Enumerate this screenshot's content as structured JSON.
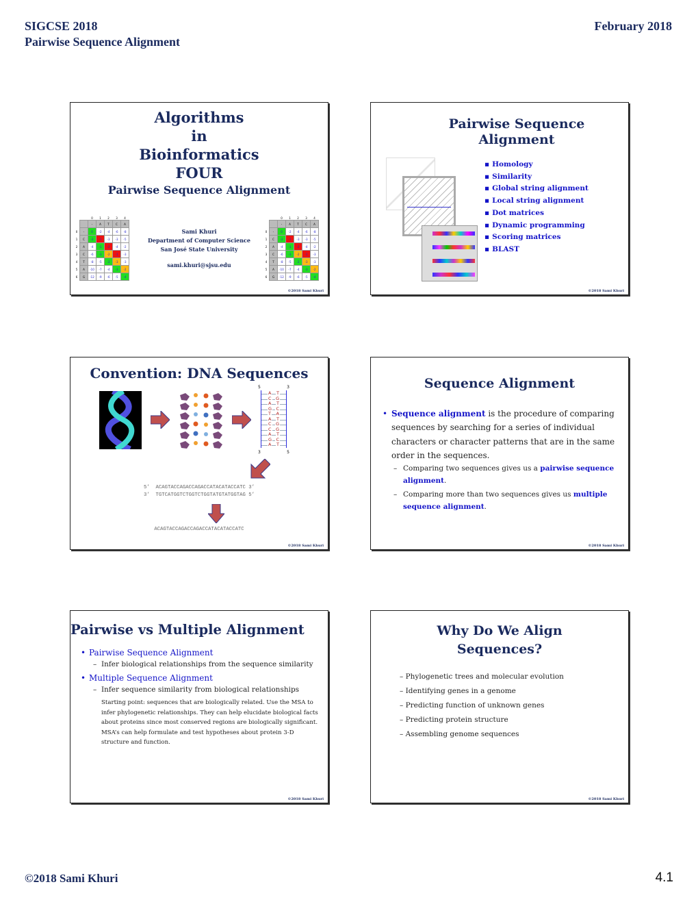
{
  "header": {
    "conference": "SIGCSE 2018",
    "date": "February 2018",
    "subtitle": "Pairwise Sequence Alignment"
  },
  "footer": {
    "copyright": "©2018 Sami Khuri",
    "page_number": "4.1"
  },
  "slide_copyright": "©2018 Sami Khuri",
  "slides": {
    "s1": {
      "title_lines": [
        "Algorithms",
        "in",
        "Bioinformatics"
      ],
      "four": "FOUR",
      "subtitle": "Pairwise Sequence Alignment",
      "author": "Sami Khuri",
      "department": "Department of Computer Science",
      "university": "San José State University",
      "email": "sami.khuri@sjsu.edu",
      "matrix": {
        "col_index": [
          "0",
          "1",
          "2",
          "3",
          "4"
        ],
        "col_header": [
          "-",
          "A",
          "T",
          "C",
          "A"
        ],
        "rows": [
          {
            "idx": "0",
            "label": "-",
            "cells": [
              "0",
              "-2",
              "-4",
              "-6",
              "-8"
            ],
            "colors": [
              "g",
              "",
              "",
              "",
              ""
            ]
          },
          {
            "idx": "1",
            "label": "C",
            "cells": [
              "-2",
              "-1",
              "-3",
              "-3",
              "-5"
            ],
            "colors": [
              "g",
              "r",
              "",
              "",
              ""
            ]
          },
          {
            "idx": "2",
            "label": "A",
            "cells": [
              "-4",
              "-1",
              "-2",
              "-4",
              "-2"
            ],
            "colors": [
              "",
              "g",
              "r",
              "",
              ""
            ]
          },
          {
            "idx": "3",
            "label": "C",
            "cells": [
              "-6",
              "-3",
              "-2",
              "-1",
              "-3"
            ],
            "colors": [
              "",
              "g",
              "o",
              "r",
              ""
            ]
          },
          {
            "idx": "4",
            "label": "T",
            "cells": [
              "-8",
              "-5",
              "-2",
              "-3",
              "-3"
            ],
            "colors": [
              "",
              "",
              "g",
              "o",
              ""
            ]
          },
          {
            "idx": "5",
            "label": "A",
            "cells": [
              "-10",
              "-7",
              "-4",
              "-3",
              "-2"
            ],
            "colors": [
              "",
              "",
              "",
              "g",
              "o"
            ]
          },
          {
            "idx": "6",
            "label": "G",
            "cells": [
              "-12",
              "-9",
              "-6",
              "-5",
              "-4"
            ],
            "colors": [
              "",
              "",
              "",
              "",
              "g"
            ]
          }
        ]
      }
    },
    "s2": {
      "title": "Pairwise Sequence Alignment",
      "items": [
        "Homology",
        "Similarity",
        "Global string alignment",
        "Local string alignment",
        "Dot matrices",
        "Dynamic programming",
        "Scoring matrices",
        "BLAST"
      ]
    },
    "s3": {
      "title": "Convention: DNA Sequences",
      "strand_top_label_left": "5",
      "strand_top_label_right": "3",
      "strand_bottom_label_left": "3",
      "strand_bottom_label_right": "5",
      "pairs": [
        [
          "A",
          "T"
        ],
        [
          "C",
          "G"
        ],
        [
          "A",
          "T"
        ],
        [
          "G",
          "C"
        ],
        [
          "T",
          "A"
        ],
        [
          "A",
          "T"
        ],
        [
          "C",
          "G"
        ],
        [
          "C",
          "G"
        ],
        [
          "A",
          "T"
        ],
        [
          "G",
          "C"
        ],
        [
          "A",
          "T"
        ]
      ],
      "seq_line1_left": "5’",
      "seq_line1": "ACAGTACCAGACCAGACCATACATACCATC",
      "seq_line1_right": "3’",
      "seq_line2_left": "3’",
      "seq_line2": "TGTCATGGTCTGGTCTGGTATGTATGGTAG",
      "seq_line2_right": "5’",
      "seq_result": "ACAGTACCAGACCAGACCATACATACCATC"
    },
    "s4": {
      "title": "Sequence Alignment",
      "lead_bold": "Sequence alignment",
      "lead_rest": " is the procedure of comparing sequences by searching for a series of individual characters or character patterns that are in the same order in the sequences.",
      "sub1_text": "Comparing two sequences gives us a ",
      "sub1_bold": "pairwise sequence alignment",
      "sub2_text": "Comparing more than two sequences gives us ",
      "sub2_bold": "multiple sequence alignment",
      "period": "."
    },
    "s5": {
      "title": "Pairwise vs Multiple Alignment",
      "b1": "Pairwise Sequence Alignment",
      "b1_sub": "Infer biological relationships from the sequence similarity",
      "b2": "Multiple Sequence Alignment",
      "b2_sub": "Infer sequence similarity from biological relationships",
      "note": "Starting point: sequences that are biologically related. Use the MSA to infer phylogenetic relationships.  They can help elucidate biological facts about proteins since most conserved regions are biologically significant.  MSA’s can help formulate and test hypotheses about protein 3-D structure and function."
    },
    "s6": {
      "title_line1": "Why Do We Align",
      "title_line2": "Sequences?",
      "items": [
        "Phylogenetic trees and molecular evolution",
        "Identifying genes in a genome",
        "Predicting function of unknown genes",
        "Predicting protein structure",
        "Assembling genome sequences"
      ]
    }
  },
  "colors": {
    "navy": "#1a2a5e",
    "title_red": "#c00000",
    "accent_blue": "#1414c8",
    "arrow_red": "#c0504d"
  }
}
